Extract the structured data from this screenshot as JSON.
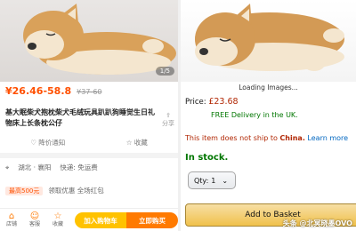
{
  "left": {
    "image_counter": "1/5",
    "price": "¥26.46-58.8",
    "original_price": "¥37-60",
    "title": "基大眠柴犬抱枕柴犬毛绒玩具趴趴狗睡觉生日礼物床上长条枕公仔",
    "share_label": "分享",
    "actions": [
      "降价通知",
      "收藏"
    ],
    "ship_from": "湖北 · 襄阳",
    "ship_fee": "快递: 免运费",
    "coupon_tag": "最高500元",
    "coupon_text": "领取优惠 全场红包",
    "bottom_icons": [
      {
        "glyph": "⌂",
        "label": "店铺"
      },
      {
        "glyph": "☺",
        "label": "客服"
      },
      {
        "glyph": "☆",
        "label": "收藏"
      }
    ],
    "add_to_cart": "加入购物车",
    "buy_now": "立即购买"
  },
  "right": {
    "loading_text": "Loading Images...",
    "price_label": "Price:",
    "price_value": "£23.68",
    "free_delivery": "FREE Delivery in the UK.",
    "no_ship_prefix": "This item does not ship to",
    "no_ship_dest": "China.",
    "learn_more": "Learn more",
    "stock": "In stock.",
    "qty_label": "Qty:",
    "qty_value": "1",
    "add_to_basket": "Add to Basket",
    "watermark": "头条 @北冥晓墨OVO"
  },
  "colors": {
    "taobao_orange": "#ff5000",
    "taobao_yellow": "#ffc200",
    "amazon_green": "#007600",
    "amazon_red": "#b12704",
    "amazon_link": "#0066c0",
    "basket_button": "#f0c14b"
  }
}
